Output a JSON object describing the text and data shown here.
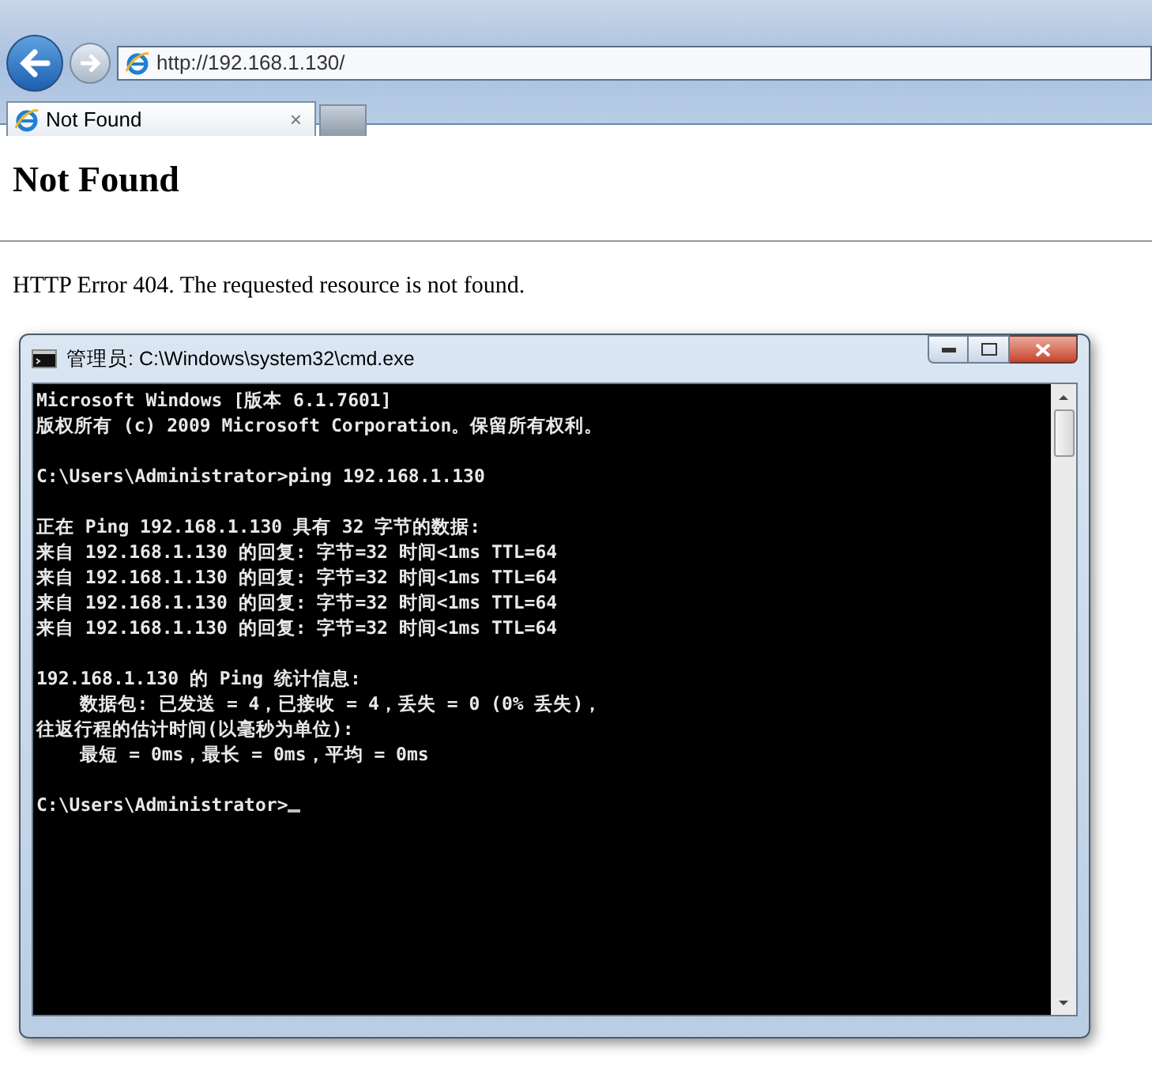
{
  "browser": {
    "address": "http://192.168.1.130/",
    "tab": {
      "title": "Not Found",
      "close": "×"
    }
  },
  "page": {
    "heading": "Not Found",
    "message": "HTTP Error 404. The requested resource is not found."
  },
  "console": {
    "title": "管理员: C:\\Windows\\system32\\cmd.exe",
    "blocks": [
      [
        "Microsoft Windows [版本 6.1.7601]",
        "版权所有 (c) 2009 Microsoft Corporation。保留所有权利。"
      ],
      [
        "C:\\Users\\Administrator>ping 192.168.1.130"
      ],
      [
        "正在 Ping 192.168.1.130 具有 32 字节的数据:",
        "来自 192.168.1.130 的回复: 字节=32 时间<1ms TTL=64",
        "来自 192.168.1.130 的回复: 字节=32 时间<1ms TTL=64",
        "来自 192.168.1.130 的回复: 字节=32 时间<1ms TTL=64",
        "来自 192.168.1.130 的回复: 字节=32 时间<1ms TTL=64"
      ],
      [
        "192.168.1.130 的 Ping 统计信息:",
        "    数据包: 已发送 = 4，已接收 = 4，丢失 = 0 (0% 丢失)，",
        "往返行程的估计时间(以毫秒为单位):",
        "    最短 = 0ms，最长 = 0ms，平均 = 0ms"
      ],
      [
        "C:\\Users\\Administrator>"
      ]
    ]
  }
}
